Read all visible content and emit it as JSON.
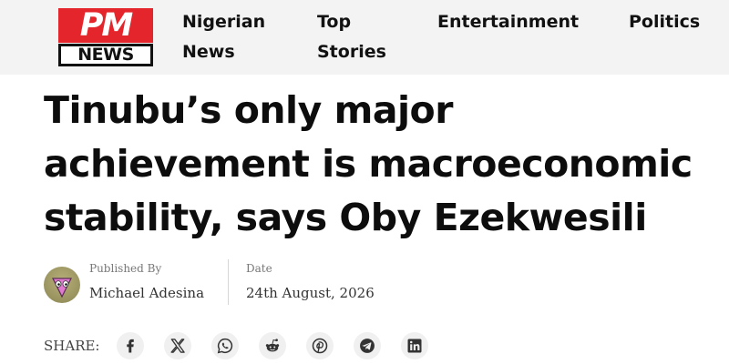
{
  "brand": {
    "logo_top": "PM",
    "logo_bottom": "NEWS",
    "accent_color": "#e4252b"
  },
  "nav": {
    "items": [
      {
        "label": "Nigerian News"
      },
      {
        "label": "Top Stories"
      },
      {
        "label": "Entertainment"
      },
      {
        "label": "Politics"
      }
    ]
  },
  "article": {
    "title": "Tinubu’s only major achievement is macroeconomic stability, says Oby Ezekwesili",
    "published_by_label": "Published By",
    "author": "Michael Adesina",
    "date_label": "Date",
    "date": "24th August, 2026"
  },
  "share": {
    "label": "SHARE:",
    "icons": [
      "facebook-icon",
      "x-icon",
      "whatsapp-icon",
      "reddit-icon",
      "pinterest-icon",
      "telegram-icon",
      "linkedin-icon"
    ]
  }
}
